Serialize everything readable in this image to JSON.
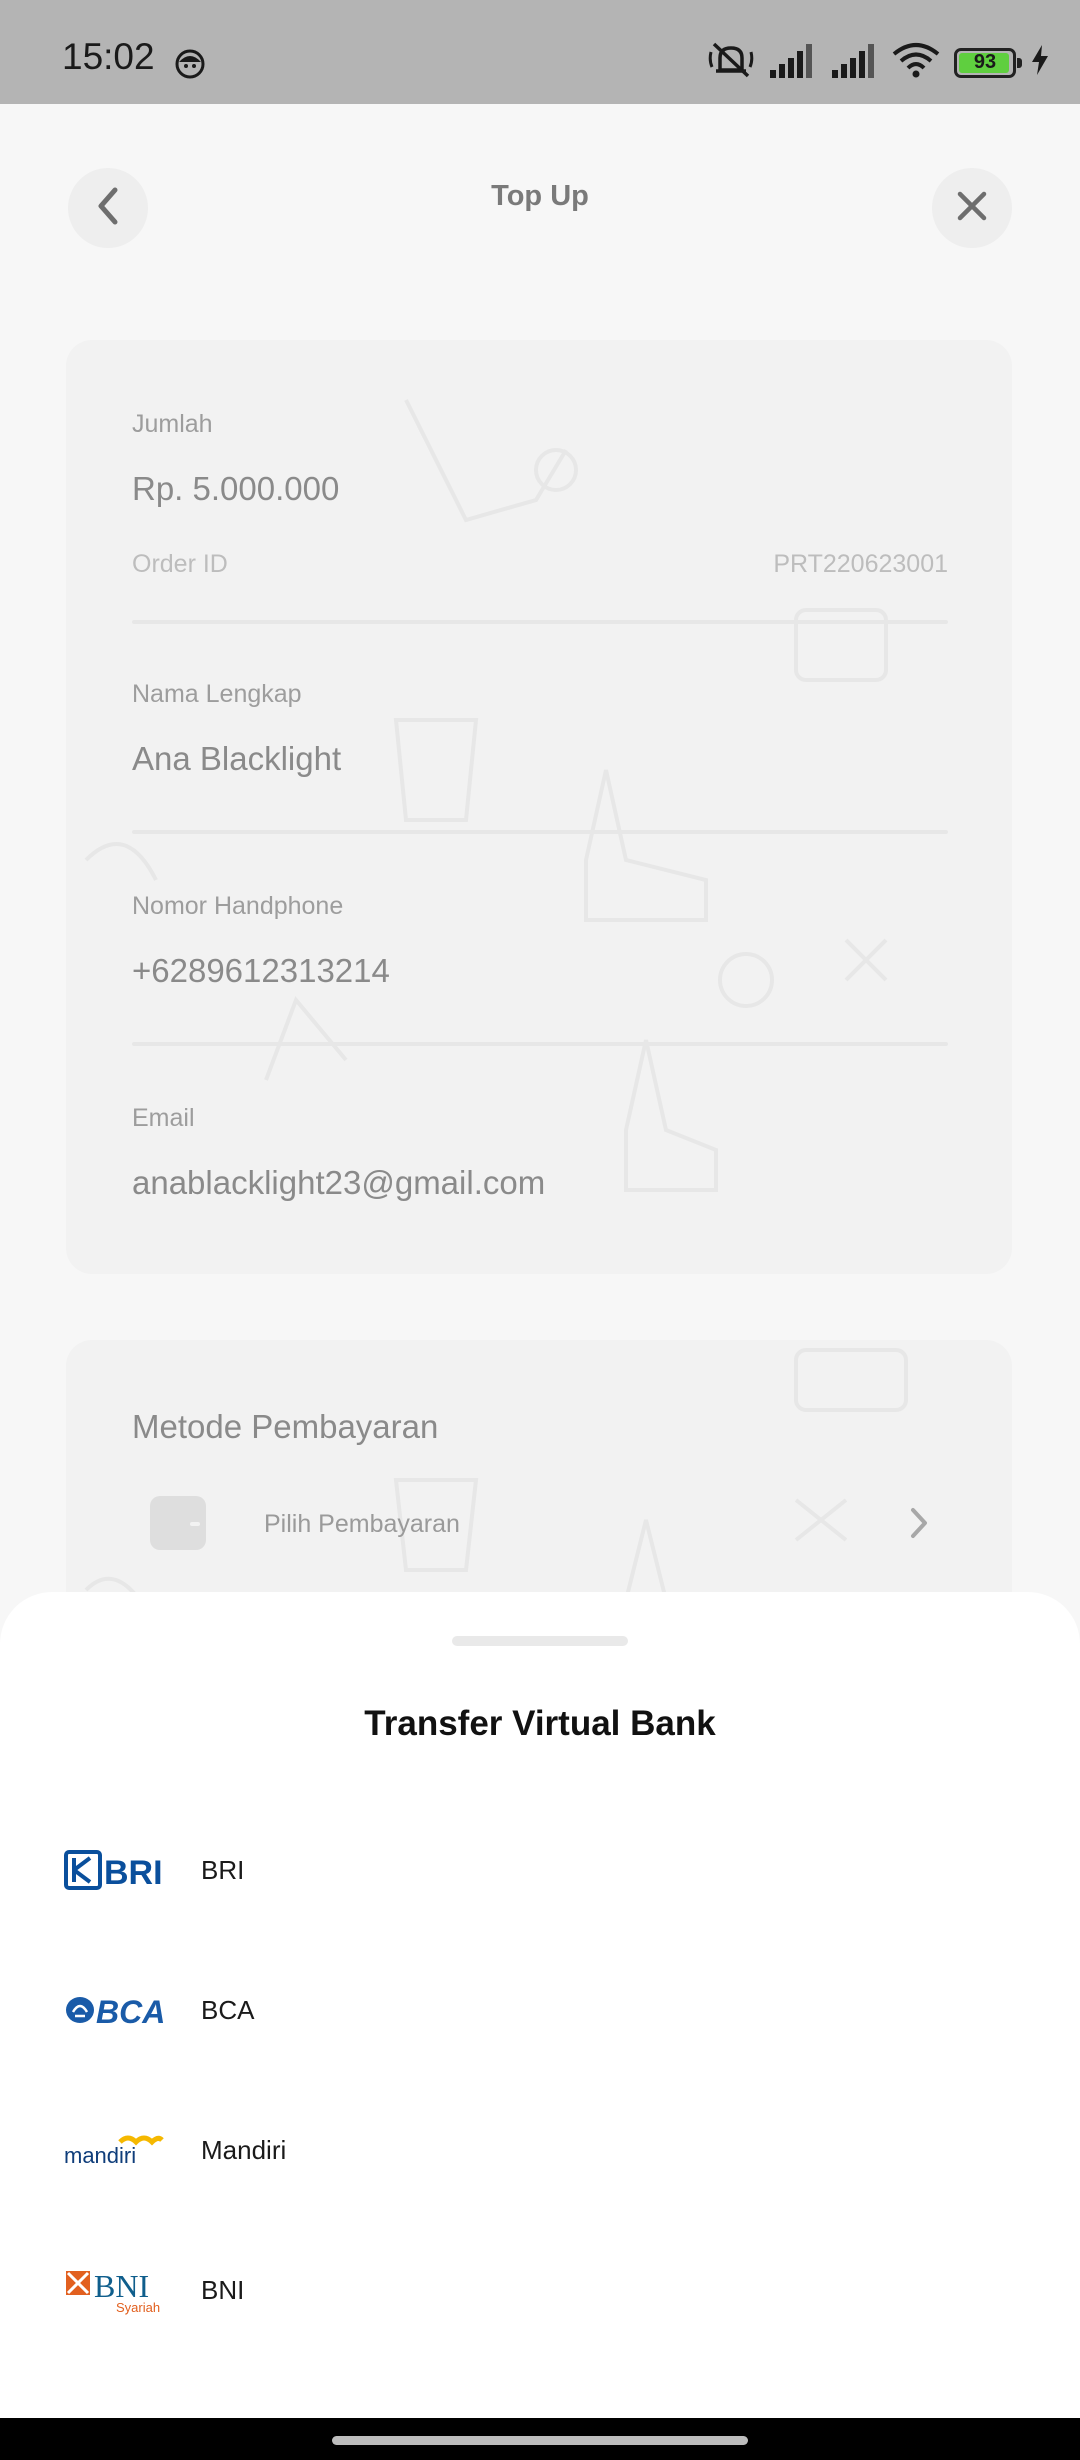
{
  "status_bar": {
    "time": "15:02",
    "battery": "93"
  },
  "header": {
    "title": "Top Up"
  },
  "form": {
    "amount_label": "Jumlah",
    "amount_value": "Rp. 5.000.000",
    "order_label": "Order ID",
    "order_value": "PRT220623001",
    "name_label": "Nama Lengkap",
    "name_value": "Ana Blacklight",
    "phone_label": "Nomor Handphone",
    "phone_value": "+6289612313214",
    "email_label": "Email",
    "email_value": "anablacklight23@gmail.com"
  },
  "payment": {
    "title": "Metode Pembayaran",
    "choose_label": "Pilih Pembayaran"
  },
  "sheet": {
    "title": "Transfer Virtual Bank",
    "banks": [
      {
        "name": "BRI",
        "logo_text": "BRI",
        "color": "#0a4f9c"
      },
      {
        "name": "BCA",
        "logo_text": "BCA",
        "color": "#1a5ba8"
      },
      {
        "name": "Mandiri",
        "logo_text": "mandiri",
        "color": "#0f3d7a",
        "accent": "#f5b800"
      },
      {
        "name": "BNI",
        "logo_text": "BNI",
        "logo_sub": "Syariah",
        "color": "#0f5e8c",
        "accent": "#e2601f"
      }
    ]
  }
}
